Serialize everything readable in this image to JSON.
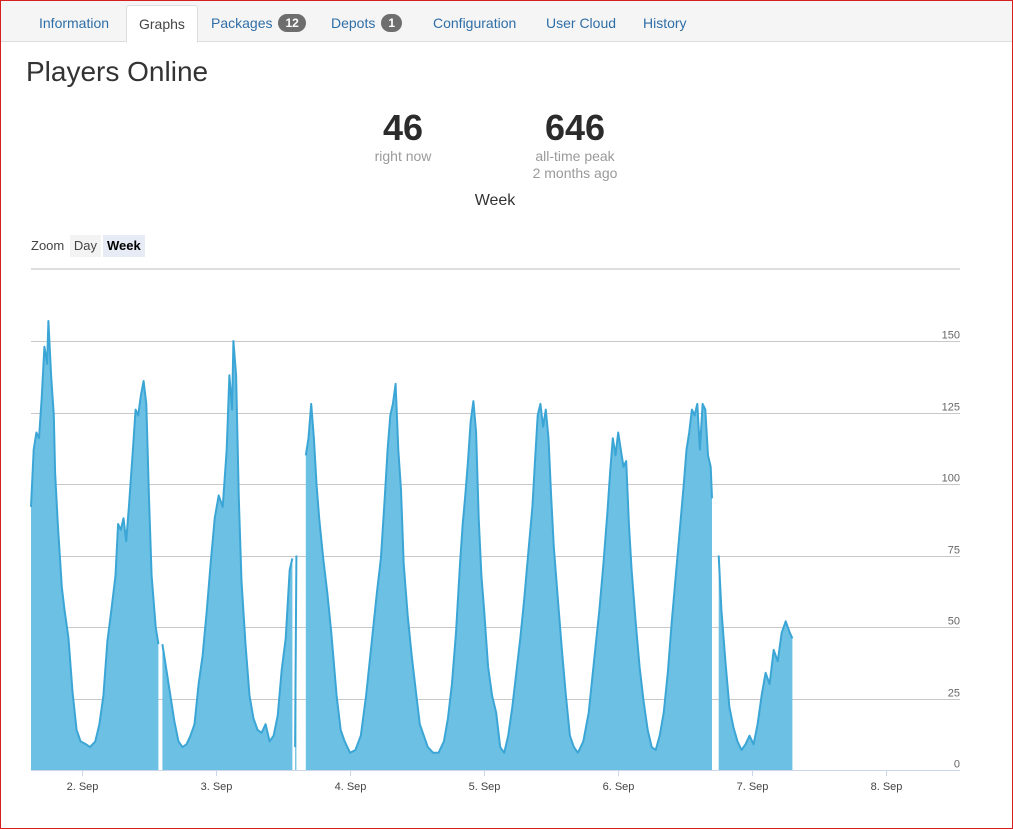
{
  "tabs": [
    {
      "label": "Information",
      "badge": null
    },
    {
      "label": "Graphs",
      "badge": null,
      "active": true
    },
    {
      "label": "Packages",
      "badge": "12"
    },
    {
      "label": "Depots",
      "badge": "1"
    },
    {
      "label": "Configuration",
      "badge": null
    },
    {
      "label": "User Cloud",
      "badge": null
    },
    {
      "label": "History",
      "badge": null
    }
  ],
  "page_title": "Players Online",
  "stats": {
    "current": {
      "value": "46",
      "label": "right now"
    },
    "peak": {
      "value": "646",
      "label": "all-time peak",
      "sublabel": "2 months ago"
    }
  },
  "zoom": {
    "label": "Zoom",
    "options": [
      "Day",
      "Week"
    ],
    "selected": "Week"
  },
  "colors": {
    "fill": "#6cc0e3",
    "line": "#3ba6d6",
    "grid": "#c8c8c8",
    "tab_link": "#2f6ea7"
  },
  "chart_data": {
    "type": "area",
    "title": "Week",
    "x_unit": "days (0 = 1 Sep 00:00)",
    "ylim": [
      0,
      160
    ],
    "y_ticks": [
      0,
      25,
      50,
      75,
      100,
      125,
      150
    ],
    "x_ticks": [
      "2. Sep",
      "3. Sep",
      "4. Sep",
      "5. Sep",
      "6. Sep",
      "7. Sep",
      "8. Sep"
    ],
    "x_tick_days": [
      2,
      3,
      4,
      5,
      6,
      7,
      8
    ],
    "xlim": [
      1.62,
      8.55
    ],
    "grid": true,
    "series": [
      {
        "segments": [
          [
            [
              1.62,
              92
            ],
            [
              1.64,
              112
            ],
            [
              1.66,
              118
            ],
            [
              1.68,
              116
            ],
            [
              1.7,
              130
            ],
            [
              1.72,
              148
            ],
            [
              1.74,
              142
            ],
            [
              1.75,
              157
            ],
            [
              1.77,
              138
            ],
            [
              1.79,
              124
            ],
            [
              1.8,
              104
            ],
            [
              1.82,
              86
            ],
            [
              1.85,
              64
            ],
            [
              1.87,
              56
            ],
            [
              1.9,
              46
            ],
            [
              1.93,
              27
            ],
            [
              1.96,
              14
            ],
            [
              1.99,
              10
            ],
            [
              2.03,
              9
            ],
            [
              2.06,
              8
            ],
            [
              2.1,
              10
            ],
            [
              2.13,
              16
            ],
            [
              2.16,
              26
            ],
            [
              2.19,
              45
            ],
            [
              2.22,
              56
            ],
            [
              2.25,
              68
            ],
            [
              2.27,
              86
            ],
            [
              2.29,
              84
            ],
            [
              2.31,
              88
            ],
            [
              2.33,
              80
            ],
            [
              2.35,
              92
            ],
            [
              2.38,
              112
            ],
            [
              2.4,
              126
            ],
            [
              2.42,
              124
            ],
            [
              2.44,
              131
            ],
            [
              2.46,
              136
            ],
            [
              2.48,
              128
            ],
            [
              2.5,
              95
            ],
            [
              2.52,
              68
            ],
            [
              2.55,
              50
            ],
            [
              2.57,
              44
            ]
          ],
          [
            [
              2.6,
              44
            ],
            [
              2.63,
              35
            ],
            [
              2.66,
              26
            ],
            [
              2.69,
              17
            ],
            [
              2.72,
              10
            ],
            [
              2.75,
              8
            ],
            [
              2.78,
              9
            ],
            [
              2.81,
              12
            ],
            [
              2.84,
              16
            ],
            [
              2.87,
              30
            ],
            [
              2.9,
              40
            ],
            [
              2.93,
              55
            ],
            [
              2.96,
              72
            ],
            [
              2.99,
              88
            ],
            [
              3.02,
              96
            ],
            [
              3.05,
              92
            ],
            [
              3.08,
              112
            ],
            [
              3.1,
              138
            ],
            [
              3.12,
              126
            ],
            [
              3.13,
              150
            ],
            [
              3.15,
              138
            ],
            [
              3.17,
              95
            ],
            [
              3.19,
              66
            ],
            [
              3.22,
              44
            ],
            [
              3.25,
              26
            ],
            [
              3.28,
              18
            ],
            [
              3.31,
              14
            ],
            [
              3.34,
              13
            ],
            [
              3.37,
              16
            ],
            [
              3.4,
              10
            ],
            [
              3.43,
              12
            ],
            [
              3.46,
              19
            ],
            [
              3.49,
              35
            ],
            [
              3.52,
              46
            ],
            [
              3.55,
              70
            ],
            [
              3.57,
              74
            ]
          ],
          [
            [
              3.59,
              8
            ],
            [
              3.6,
              75
            ]
          ],
          [
            [
              3.67,
              110
            ],
            [
              3.69,
              116
            ],
            [
              3.71,
              128
            ],
            [
              3.73,
              116
            ],
            [
              3.75,
              100
            ],
            [
              3.77,
              88
            ],
            [
              3.8,
              74
            ],
            [
              3.83,
              62
            ],
            [
              3.86,
              48
            ],
            [
              3.9,
              26
            ],
            [
              3.93,
              14
            ],
            [
              3.96,
              10
            ],
            [
              4.0,
              6
            ],
            [
              4.04,
              7
            ],
            [
              4.08,
              12
            ],
            [
              4.12,
              26
            ],
            [
              4.16,
              44
            ],
            [
              4.2,
              62
            ],
            [
              4.23,
              74
            ],
            [
              4.26,
              96
            ],
            [
              4.28,
              112
            ],
            [
              4.3,
              124
            ],
            [
              4.32,
              128
            ],
            [
              4.34,
              135
            ],
            [
              4.36,
              112
            ],
            [
              4.38,
              98
            ],
            [
              4.4,
              72
            ],
            [
              4.43,
              54
            ],
            [
              4.46,
              40
            ],
            [
              4.49,
              28
            ],
            [
              4.52,
              16
            ],
            [
              4.55,
              12
            ],
            [
              4.58,
              8
            ],
            [
              4.62,
              6
            ],
            [
              4.66,
              6
            ],
            [
              4.7,
              10
            ],
            [
              4.73,
              18
            ],
            [
              4.76,
              30
            ],
            [
              4.79,
              48
            ],
            [
              4.82,
              72
            ],
            [
              4.84,
              86
            ],
            [
              4.86,
              96
            ],
            [
              4.88,
              108
            ],
            [
              4.9,
              122
            ],
            [
              4.92,
              129
            ],
            [
              4.94,
              118
            ],
            [
              4.96,
              88
            ],
            [
              4.98,
              68
            ],
            [
              5.0,
              56
            ],
            [
              5.03,
              36
            ],
            [
              5.06,
              26
            ],
            [
              5.09,
              20
            ],
            [
              5.12,
              8
            ],
            [
              5.15,
              6
            ],
            [
              5.18,
              12
            ],
            [
              5.21,
              22
            ],
            [
              5.24,
              34
            ],
            [
              5.27,
              46
            ],
            [
              5.3,
              60
            ],
            [
              5.33,
              76
            ],
            [
              5.36,
              92
            ],
            [
              5.38,
              108
            ],
            [
              5.4,
              124
            ],
            [
              5.42,
              128
            ],
            [
              5.44,
              120
            ],
            [
              5.46,
              126
            ],
            [
              5.48,
              116
            ],
            [
              5.5,
              96
            ],
            [
              5.52,
              78
            ],
            [
              5.55,
              60
            ],
            [
              5.58,
              42
            ],
            [
              5.61,
              26
            ],
            [
              5.64,
              12
            ],
            [
              5.67,
              8
            ],
            [
              5.7,
              6
            ],
            [
              5.74,
              10
            ],
            [
              5.78,
              20
            ],
            [
              5.82,
              38
            ],
            [
              5.86,
              56
            ],
            [
              5.89,
              72
            ],
            [
              5.92,
              90
            ],
            [
              5.94,
              104
            ],
            [
              5.96,
              116
            ],
            [
              5.98,
              110
            ],
            [
              6.0,
              118
            ],
            [
              6.02,
              112
            ],
            [
              6.04,
              106
            ],
            [
              6.06,
              108
            ],
            [
              6.08,
              86
            ],
            [
              6.1,
              70
            ],
            [
              6.13,
              52
            ],
            [
              6.16,
              36
            ],
            [
              6.19,
              24
            ],
            [
              6.22,
              14
            ],
            [
              6.25,
              8
            ],
            [
              6.28,
              7
            ],
            [
              6.31,
              12
            ],
            [
              6.34,
              20
            ],
            [
              6.37,
              34
            ],
            [
              6.4,
              52
            ],
            [
              6.43,
              68
            ],
            [
              6.46,
              84
            ],
            [
              6.49,
              100
            ],
            [
              6.51,
              112
            ],
            [
              6.53,
              118
            ],
            [
              6.55,
              126
            ],
            [
              6.57,
              124
            ],
            [
              6.59,
              128
            ],
            [
              6.61,
              112
            ],
            [
              6.63,
              128
            ],
            [
              6.65,
              126
            ],
            [
              6.67,
              110
            ],
            [
              6.69,
              106
            ],
            [
              6.7,
              95
            ]
          ],
          [
            [
              6.75,
              75
            ],
            [
              6.77,
              56
            ],
            [
              6.8,
              38
            ],
            [
              6.83,
              22
            ],
            [
              6.86,
              15
            ],
            [
              6.89,
              10
            ],
            [
              6.92,
              7
            ],
            [
              6.95,
              9
            ],
            [
              6.98,
              12
            ],
            [
              7.01,
              9
            ],
            [
              7.04,
              16
            ],
            [
              7.07,
              26
            ],
            [
              7.1,
              34
            ],
            [
              7.13,
              30
            ],
            [
              7.16,
              42
            ],
            [
              7.19,
              38
            ],
            [
              7.22,
              48
            ],
            [
              7.25,
              52
            ],
            [
              7.28,
              48
            ],
            [
              7.3,
              46
            ]
          ]
        ]
      }
    ]
  }
}
